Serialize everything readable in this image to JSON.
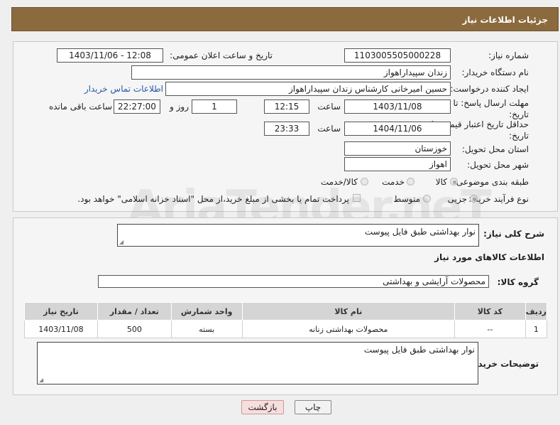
{
  "header": {
    "title": "جزئیات اطلاعات نیاز"
  },
  "form": {
    "need_number_label": "شماره نیاز:",
    "need_number": "1103005505000228",
    "announce_label": "تاریخ و ساعت اعلان عمومی:",
    "announce_value": "1403/11/06 - 12:08",
    "buyer_org_label": "نام دستگاه خریدار:",
    "buyer_org": "زندان سپیداراهواز",
    "creator_label": "ایجاد کننده درخواست:",
    "creator": "حسین امیرخانی کارشناس زندان سپیداراهواز",
    "contact_link": "اطلاعات تماس خریدار",
    "reply_deadline_label": "مهلت ارسال پاسخ: تا تاریخ:",
    "reply_date": "1403/11/08",
    "time_label": "ساعت",
    "reply_time": "12:15",
    "days": "1",
    "days_label": "روز و",
    "remaining_time": "22:27:00",
    "remaining_label": "ساعت باقی مانده",
    "price_validity_label": "حداقل تاریخ اعتبار قیمت: تا تاریخ:",
    "validity_date": "1404/11/06",
    "validity_time": "23:33",
    "province_label": "استان محل تحویل:",
    "province": "خوزستان",
    "city_label": "شهر محل تحویل:",
    "city": "اهواز",
    "category_label": "طبقه بندی موضوعی:",
    "category_options": [
      "کالا",
      "خدمت",
      "کالا/خدمت"
    ],
    "category_selected": "کالا",
    "process_label": "نوع فرآیند خرید :",
    "process_options": [
      "جزیی",
      "متوسط"
    ],
    "payment_note": "پرداخت تمام یا بخشی از مبلغ خرید،از محل \"اسناد خزانه اسلامی\" خواهد بود."
  },
  "summary": {
    "desc_label": "شرح کلی نیاز:",
    "desc_value": "نوار بهداشتی  طبق فایل پیوست",
    "goods_info_title": "اطلاعات کالاهای مورد نیاز",
    "group_label": "گروه کالا:",
    "group_value": "محصولات آرایشی و بهداشتی"
  },
  "table": {
    "headers": [
      "ردیف",
      "کد کالا",
      "نام کالا",
      "واحد شمارش",
      "تعداد / مقدار",
      "تاریخ نیاز"
    ],
    "rows": [
      [
        "1",
        "--",
        "محصولات بهداشتی زنانه",
        "بسته",
        "500",
        "1403/11/08"
      ]
    ]
  },
  "buyer_notes": {
    "label": "توضیحات خریدار:",
    "value": "نوار بهداشتی  طبق فایل پیوست"
  },
  "buttons": {
    "print": "چاپ",
    "back": "بازگشت"
  },
  "watermark": "AriaTender.neT"
}
